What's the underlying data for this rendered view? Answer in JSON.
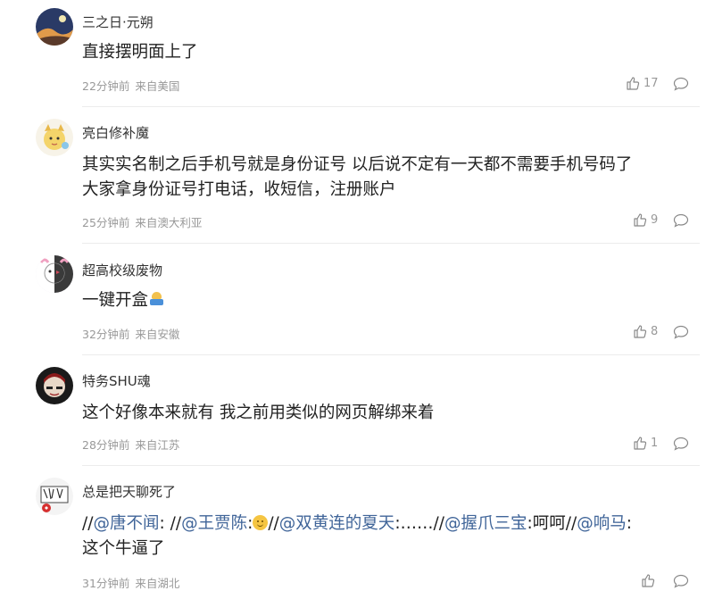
{
  "comments": [
    {
      "username": "三之日·元朔",
      "text": "直接摆明面上了",
      "time": "22分钟前",
      "location": "来自美国",
      "likes": "17"
    },
    {
      "username": "亮白修补魔",
      "text_line1": "其实实名制之后手机号就是身份证号 以后说不定有一天都不需要手机号码了",
      "text_line2": "大家拿身份证号打电话，收短信，注册账户",
      "time": "25分钟前",
      "location": "来自澳大利亚",
      "likes": "9"
    },
    {
      "username": "超高校级废物",
      "text": "一键开盒",
      "emoji": "unbox-emoji",
      "time": "32分钟前",
      "location": "来自安徽",
      "likes": "8"
    },
    {
      "username": "特务SHU魂",
      "text": "这个好像本来就有 我之前用类似的网页解绑来着",
      "time": "28分钟前",
      "location": "来自江苏",
      "likes": "1"
    },
    {
      "username": "总是把天聊死了",
      "parts": {
        "p1": "//",
        "m1": "@唐不闻",
        "p2": ": //",
        "m2": "@王贾陈",
        "p3": ":",
        "p4": "//",
        "m3": "@双黄连的夏天",
        "p5": ":……//",
        "m4": "@握爪三宝",
        "p6": ":呵呵//",
        "m5": "@响马",
        "p7": ":"
      },
      "text_line2": "这个牛逼了",
      "emoji": "smile-emoji",
      "time": "31分钟前",
      "location": "来自湖北",
      "likes": ""
    }
  ],
  "colors": {
    "mention": "#406599",
    "meta": "#999999",
    "divider": "#ececec"
  },
  "icons": {
    "like": "thumbs-up-icon",
    "reply": "comment-bubble-icon"
  }
}
